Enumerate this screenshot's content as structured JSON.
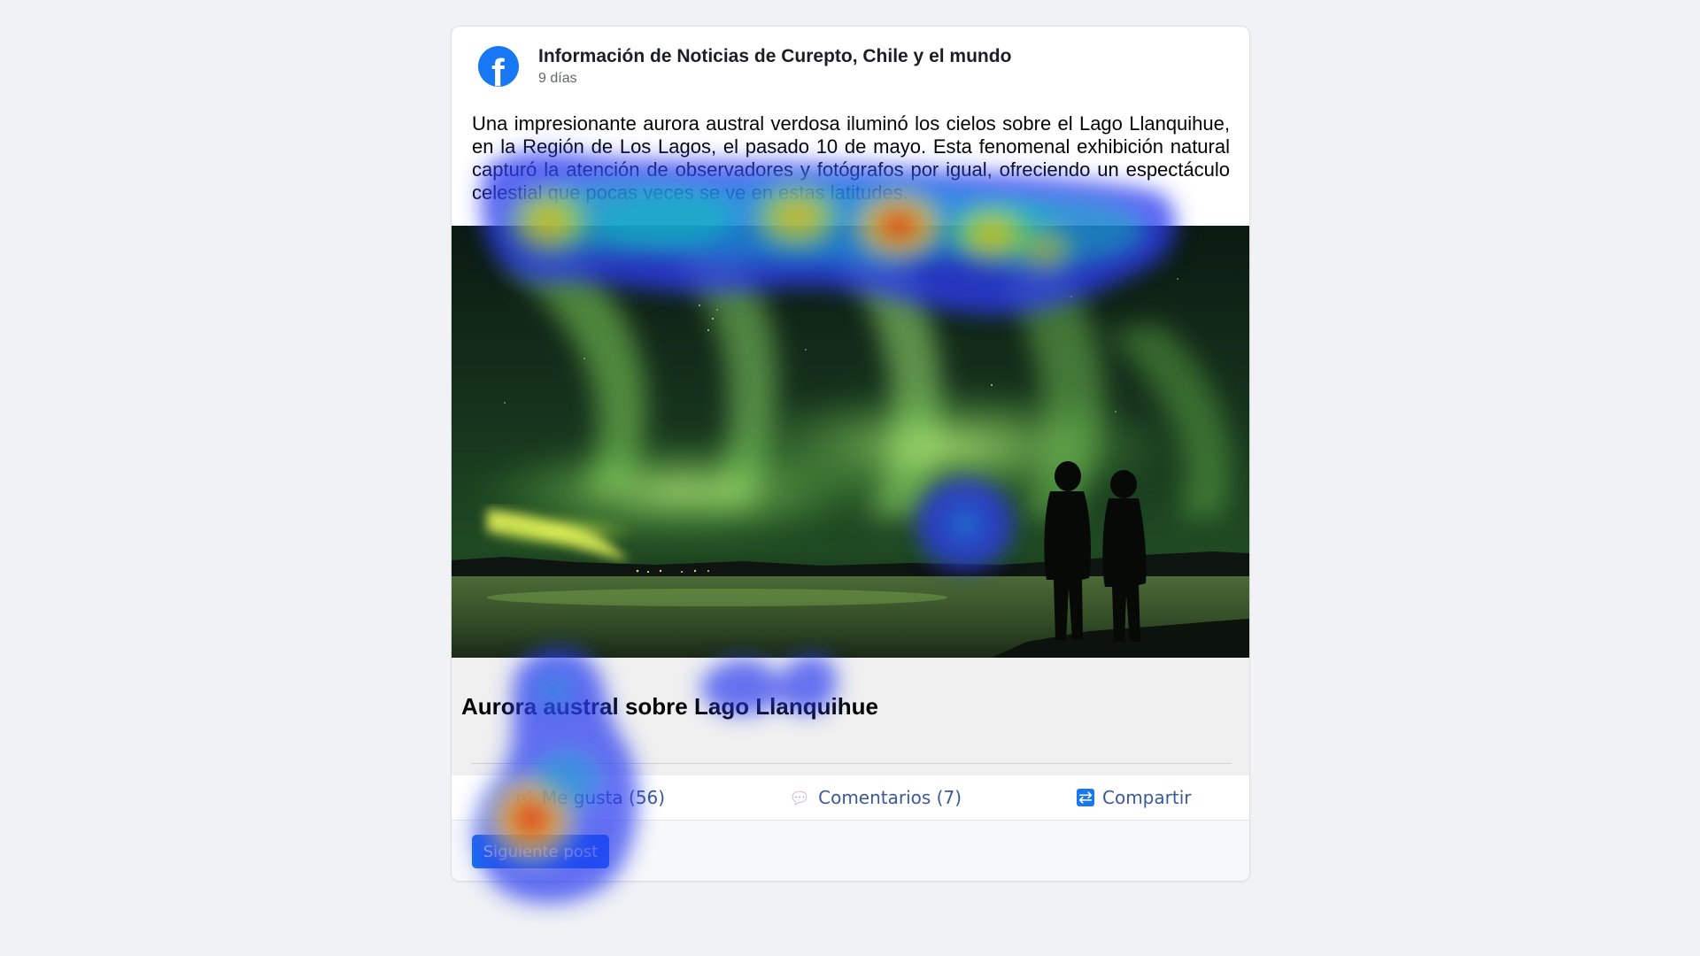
{
  "post": {
    "page_name": "Información de Noticias de Curepto, Chile y el mundo",
    "time": "9 días",
    "text": "Una impresionante aurora austral verdosa iluminó los cielos sobre el Lago Llanquihue, en la Región de Los Lagos, el pasado 10 de mayo. Esta fenomenal exhibición natural capturó la atención de observadores y fotógrafos por igual, ofreciendo un espectáculo celestial que pocas veces se ve en estas latitudes.",
    "link_title": "Aurora austral sobre Lago Llanquihue"
  },
  "actions": {
    "like_label": "Me gusta (56)",
    "comment_label": "Comentarios (7)",
    "share_label": "Compartir"
  },
  "footer": {
    "next_button": "Siguiente post"
  },
  "icons": {
    "logo": "facebook-logo-icon",
    "like": "thumbs-up-icon",
    "comment": "speech-bubble-icon",
    "share": "share-icon"
  },
  "colors": {
    "brand": "#1877f2",
    "action_text": "#3b5998",
    "page_background": "#f0f2f5"
  }
}
